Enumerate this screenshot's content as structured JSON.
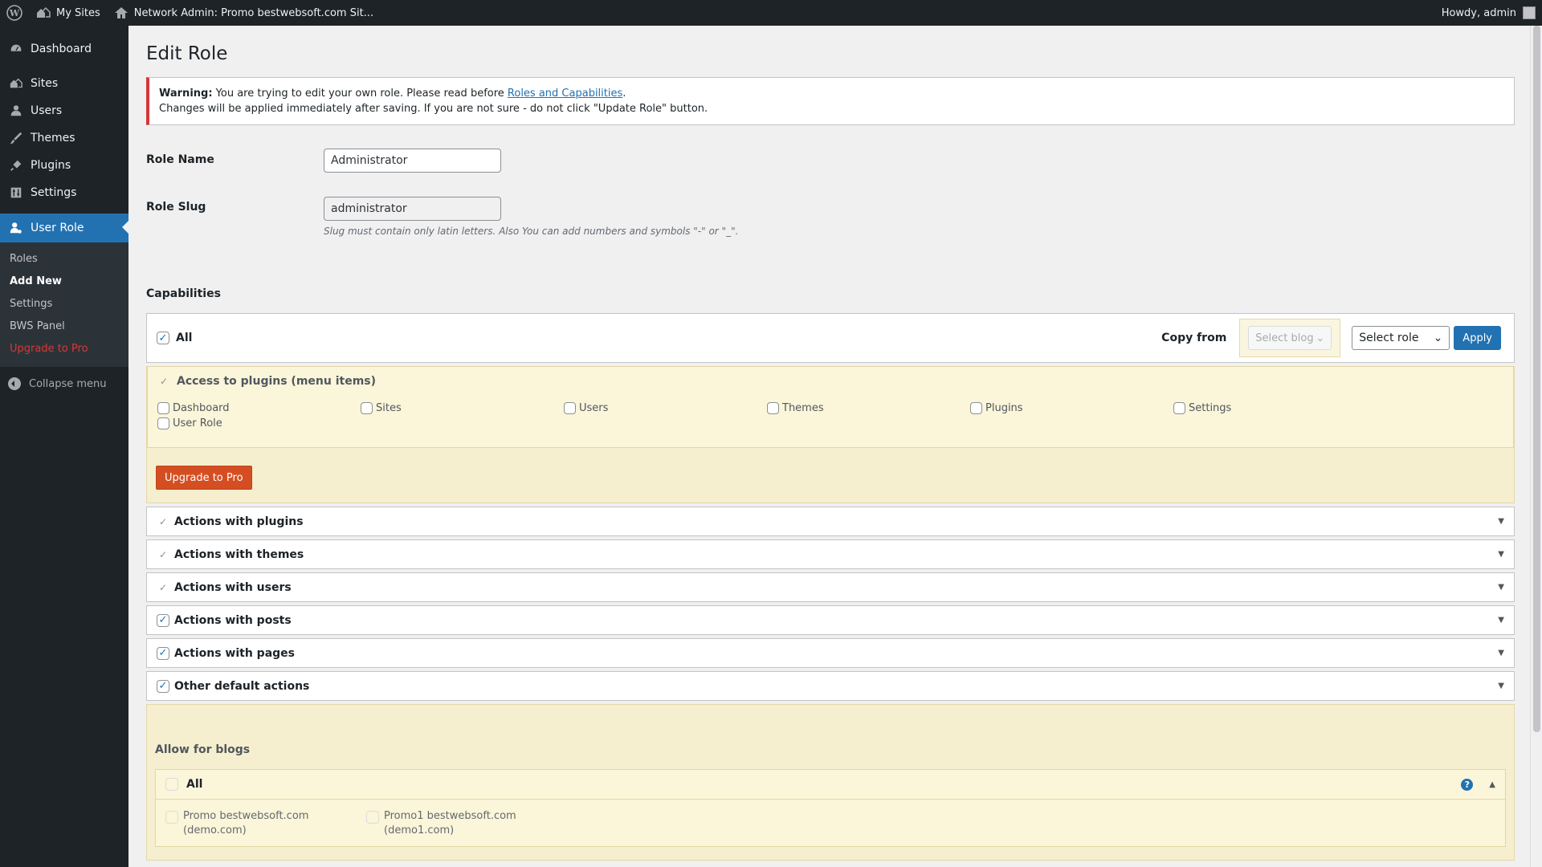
{
  "adminbar": {
    "my_sites": "My Sites",
    "network_admin": "Network Admin: Promo bestwebsoft.com Sit...",
    "howdy": "Howdy, admin"
  },
  "menu": {
    "dashboard": "Dashboard",
    "sites": "Sites",
    "users": "Users",
    "themes": "Themes",
    "plugins": "Plugins",
    "settings": "Settings",
    "user_role": "User Role",
    "submenu": {
      "roles": "Roles",
      "add_new": "Add New",
      "settings": "Settings",
      "bws_panel": "BWS Panel",
      "upgrade": "Upgrade to Pro"
    },
    "collapse": "Collapse menu"
  },
  "page": {
    "title": "Edit Role",
    "notice": {
      "warning_label": "Warning:",
      "warning_text": " You are trying to edit your own role. Please read before ",
      "link": "Roles and Capabilities",
      "warning_end": ".",
      "line2": "Changes will be applied immediately after saving. If you are not sure - do not click \"Update Role\" button."
    },
    "role_name_label": "Role Name",
    "role_name_value": "Administrator",
    "role_slug_label": "Role Slug",
    "role_slug_value": "administrator",
    "slug_desc": "Slug must contain only latin letters. Also You can add numbers and symbols \"-\" or \"_\".",
    "capabilities_heading": "Capabilities",
    "all_label": "All",
    "copy_from": "Copy from",
    "select_blog": "Select blog",
    "select_role": "Select role",
    "apply": "Apply",
    "plugins_access": {
      "title": "Access to plugins (menu items)",
      "items": [
        "Dashboard",
        "Sites",
        "Users",
        "Themes",
        "Plugins",
        "Settings",
        "User Role"
      ]
    },
    "upgrade_button": "Upgrade to Pro",
    "accordions": [
      {
        "label": "Actions with plugins",
        "state": "partial"
      },
      {
        "label": "Actions with themes",
        "state": "partial"
      },
      {
        "label": "Actions with users",
        "state": "partial"
      },
      {
        "label": "Actions with posts",
        "state": "checked"
      },
      {
        "label": "Actions with pages",
        "state": "checked"
      },
      {
        "label": "Other default actions",
        "state": "checked"
      }
    ],
    "allow_blogs": {
      "title": "Allow for blogs",
      "all": "All",
      "help": "?",
      "blogs": [
        {
          "name": "Promo bestwebsoft.com",
          "domain": "(demo.com)"
        },
        {
          "name": "Promo1 bestwebsoft.com",
          "domain": "(demo1.com)"
        }
      ]
    }
  }
}
